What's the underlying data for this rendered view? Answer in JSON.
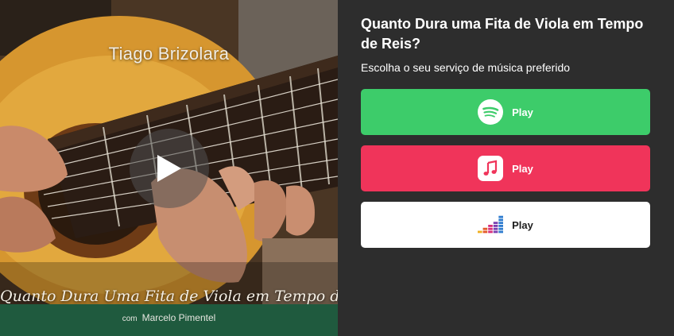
{
  "cover": {
    "artist": "Tiago Brizolara",
    "title": "Quanto Dura Uma Fita de Viola em Tempo de Reis?",
    "subtitle_prefix": "com",
    "subtitle_name": "Marcelo Pimentel"
  },
  "panel": {
    "title": "Quanto Dura uma Fita de Viola em Tempo de Reis?",
    "subtitle": "Escolha o seu serviço de música preferido"
  },
  "services": [
    {
      "name": "spotify",
      "label": "Play",
      "icon": "spotify-icon",
      "color": "#3dcc6a"
    },
    {
      "name": "apple-music",
      "label": "Play",
      "icon": "apple-music-icon",
      "color": "#f0345a"
    },
    {
      "name": "deezer",
      "label": "Play",
      "icon": "deezer-icon",
      "color": "#ffffff"
    }
  ]
}
